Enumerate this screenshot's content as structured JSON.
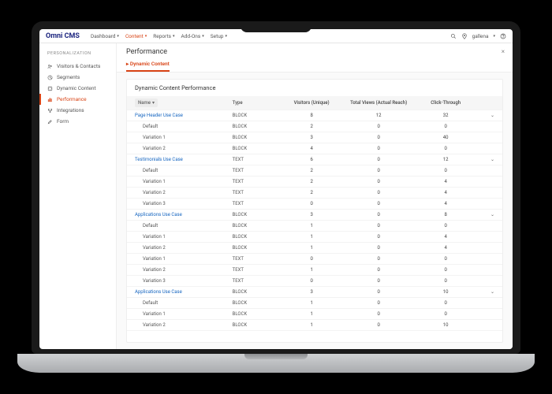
{
  "brand": "Omni CMS",
  "nav": {
    "items": [
      {
        "label": "Dashboard",
        "active": false
      },
      {
        "label": "Content",
        "active": true
      },
      {
        "label": "Reports",
        "active": false
      },
      {
        "label": "Add-Ons",
        "active": false
      },
      {
        "label": "Setup",
        "active": false
      }
    ]
  },
  "user": {
    "name": "gallena"
  },
  "sidebar": {
    "heading": "PERSONALIZATION",
    "items": [
      {
        "icon": "people-icon",
        "label": "Visitors & Contacts"
      },
      {
        "icon": "segments-icon",
        "label": "Segments"
      },
      {
        "icon": "puzzle-icon",
        "label": "Dynamic Content"
      },
      {
        "icon": "chart-icon",
        "label": "Performance",
        "active": true
      },
      {
        "icon": "integrations-icon",
        "label": "Integrations"
      },
      {
        "icon": "form-icon",
        "label": "Form"
      }
    ]
  },
  "page": {
    "title": "Performance",
    "tabs": [
      {
        "label": "Dynamic Content",
        "active": true
      }
    ],
    "panel_title": "Dynamic Content Performance",
    "columns": [
      "Name",
      "Type",
      "Visitors (Unique)",
      "Total Views (Actual Reach)",
      "Click-Through",
      ""
    ],
    "sort_indicator": "▾",
    "rows": [
      {
        "name": "Page Header Use Case",
        "type": "BLOCK",
        "visitors": 8,
        "views": 12,
        "ct": 32,
        "parent": true
      },
      {
        "name": "Default",
        "type": "BLOCK",
        "visitors": 2,
        "views": 0,
        "ct": 0
      },
      {
        "name": "Variation 1",
        "type": "BLOCK",
        "visitors": 3,
        "views": 0,
        "ct": 40
      },
      {
        "name": "Variation 2",
        "type": "BLOCK",
        "visitors": 4,
        "views": 0,
        "ct": 0
      },
      {
        "name": "Testimonials Use Case",
        "type": "TEXT",
        "visitors": 6,
        "views": 0,
        "ct": 12,
        "parent": true
      },
      {
        "name": "Default",
        "type": "TEXT",
        "visitors": 2,
        "views": 0,
        "ct": 0
      },
      {
        "name": "Variation 1",
        "type": "TEXT",
        "visitors": 2,
        "views": 0,
        "ct": 4
      },
      {
        "name": "Variation 2",
        "type": "TEXT",
        "visitors": 2,
        "views": 0,
        "ct": 4
      },
      {
        "name": "Variation 3",
        "type": "TEXT",
        "visitors": 0,
        "views": 0,
        "ct": 4
      },
      {
        "name": "Applications Use Case",
        "type": "BLOCK",
        "visitors": 3,
        "views": 0,
        "ct": 8,
        "parent": true
      },
      {
        "name": "Default",
        "type": "BLOCK",
        "visitors": 1,
        "views": 0,
        "ct": 0
      },
      {
        "name": "Variation 1",
        "type": "BLOCK",
        "visitors": 1,
        "views": 0,
        "ct": 4
      },
      {
        "name": "Variation 2",
        "type": "BLOCK",
        "visitors": 1,
        "views": 0,
        "ct": 4
      },
      {
        "name": "Variation 1",
        "type": "TEXT",
        "visitors": 0,
        "views": 0,
        "ct": 0
      },
      {
        "name": "Variation 2",
        "type": "TEXT",
        "visitors": 1,
        "views": 0,
        "ct": 0
      },
      {
        "name": "Variation 3",
        "type": "TEXT",
        "visitors": 0,
        "views": 0,
        "ct": 0
      },
      {
        "name": "Applications Use Case",
        "type": "BLOCK",
        "visitors": 3,
        "views": 0,
        "ct": 10,
        "parent": true
      },
      {
        "name": "Default",
        "type": "BLOCK",
        "visitors": 1,
        "views": 0,
        "ct": 0
      },
      {
        "name": "Variation 1",
        "type": "BLOCK",
        "visitors": 1,
        "views": 0,
        "ct": 0
      },
      {
        "name": "Variation 2",
        "type": "BLOCK",
        "visitors": 1,
        "views": 0,
        "ct": 10
      }
    ]
  }
}
